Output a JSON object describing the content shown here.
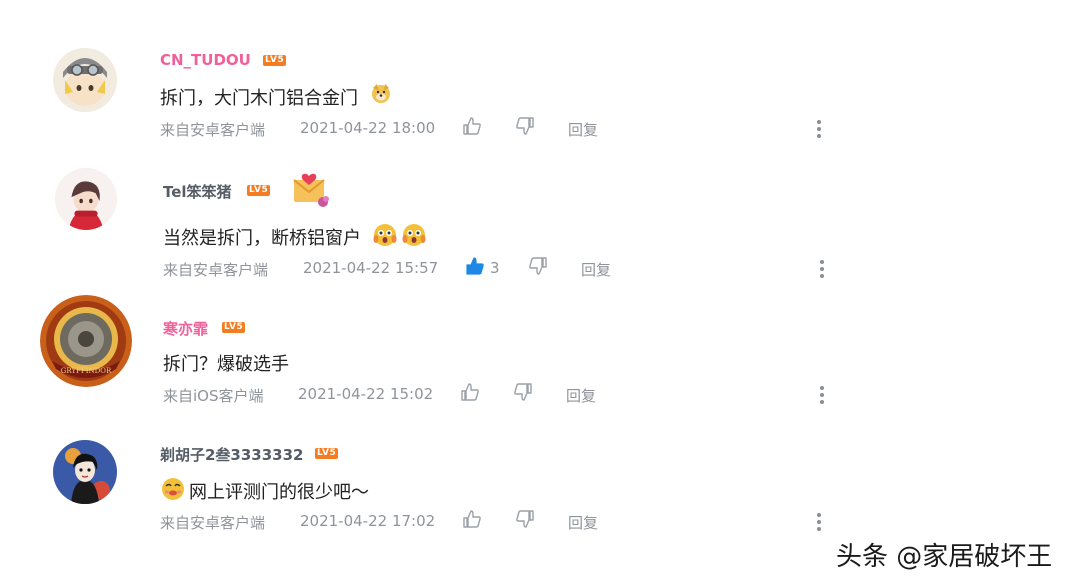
{
  "comments": [
    {
      "username": "CN_TUDOU",
      "level": "LV5",
      "text": "拆门，大门木门铝合金门",
      "source": "来自安卓客户端",
      "time": "2021-04-22 18:00",
      "likes": "",
      "reply_label": "回复"
    },
    {
      "username": "Tel笨笨猪",
      "level": "LV5",
      "text": "当然是拆门，断桥铝窗户",
      "source": "来自安卓客户端",
      "time": "2021-04-22 15:57",
      "likes": "3",
      "reply_label": "回复"
    },
    {
      "username": "寒亦霏",
      "level": "LV5",
      "text": "拆门？爆破选手",
      "source": "来自iOS客户端",
      "time": "2021-04-22 15:02",
      "likes": "",
      "reply_label": "回复"
    },
    {
      "username": "剃胡子2叁3333332",
      "level": "LV5",
      "text": "网上评测门的很少吧～",
      "source": "来自安卓客户端",
      "time": "2021-04-22 17:02",
      "likes": "",
      "reply_label": "回复"
    }
  ],
  "watermark": "头条 @家居破坏王",
  "colors": {
    "username_pink": "#f0609a",
    "username_gray": "#555c66",
    "level_badge": "#f57c20",
    "meta_gray": "#8f949a",
    "liked_blue": "#1e88e5"
  }
}
